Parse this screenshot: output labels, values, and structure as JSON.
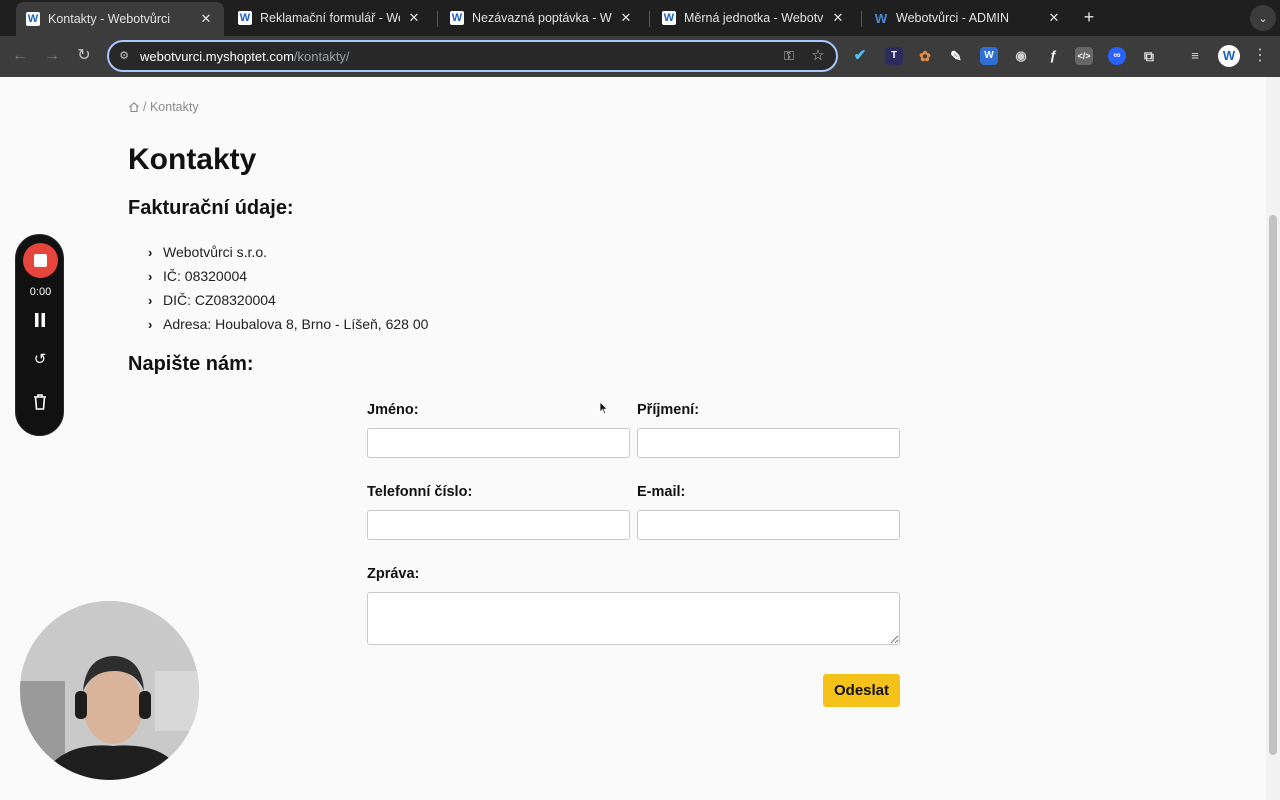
{
  "browser": {
    "tabs": [
      {
        "title": "Kontakty - Webotvůrci",
        "favicon": "W"
      },
      {
        "title": "Reklamační formulář - Webotvůrci",
        "favicon": "W"
      },
      {
        "title": "Nezávazná poptávka - Webotvůrci",
        "favicon": "W"
      },
      {
        "title": "Měrná jednotka - Webotvůrci",
        "favicon": "W"
      },
      {
        "title": "Webotvůrci - ADMIN",
        "favicon": "W"
      }
    ],
    "url_host": "webotvurci.myshoptet.com",
    "url_path": "/kontakty/",
    "profile_initial": "W",
    "extensions": [
      "check-icon",
      "translate-icon",
      "cookie-icon",
      "eyedropper-icon",
      "word-icon",
      "camera-icon",
      "formula-icon",
      "code-icon",
      "vpn-icon",
      "puzzle-icon"
    ]
  },
  "page": {
    "breadcrumb_current": "Kontakty",
    "title": "Kontakty",
    "billing_heading": "Fakturační údaje:",
    "billing_items": [
      "Webotvůrci s.r.o.",
      "IČ: 08320004",
      "DIČ: CZ08320004",
      "Adresa: Houbalova 8, Brno - Líšeň, 628 00"
    ],
    "contact_heading": "Napište nám:",
    "form": {
      "first_name_label": "Jméno:",
      "last_name_label": "Příjmení:",
      "phone_label": "Telefonní číslo:",
      "email_label": "E-mail:",
      "message_label": "Zpráva:",
      "first_name_value": "",
      "last_name_value": "",
      "phone_value": "",
      "email_value": "",
      "message_value": "",
      "submit_label": "Odeslat"
    }
  },
  "recorder": {
    "time": "0:00"
  },
  "colors": {
    "accent_button": "#f5c219",
    "record_red": "#e5453b",
    "omnibox_focus": "#a8c7fa"
  }
}
